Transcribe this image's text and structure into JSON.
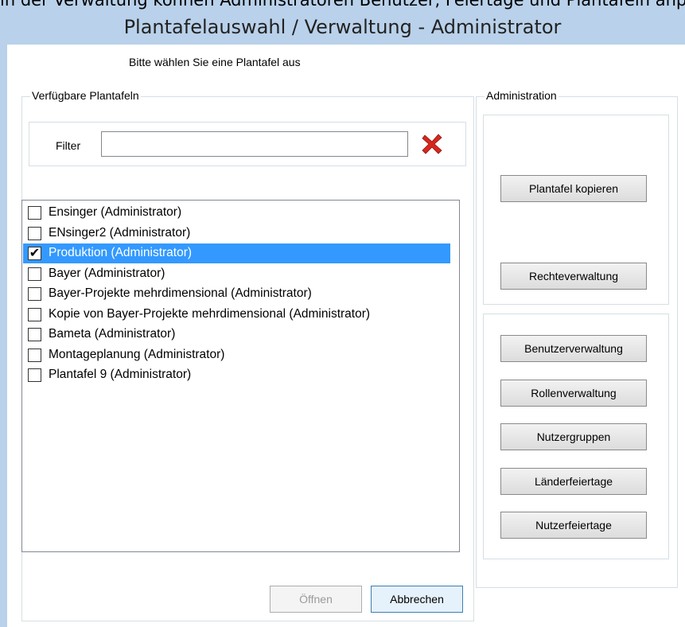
{
  "top_caption": "in der Verwaltung können Administratoren Benutzer, Feiertage und Plantafeln anpassen",
  "window": {
    "title": "Plantafelauswahl / Verwaltung - Administrator"
  },
  "instruction": "Bitte wählen Sie eine Plantafel aus",
  "available": {
    "group_label": "Verfügbare Plantafeln",
    "filter_label": "Filter",
    "filter_value": "",
    "items": [
      {
        "label": "Ensinger (Administrator)",
        "checked": false,
        "selected": false
      },
      {
        "label": "ENsinger2 (Administrator)",
        "checked": false,
        "selected": false
      },
      {
        "label": "Produktion (Administrator)",
        "checked": true,
        "selected": true
      },
      {
        "label": "Bayer (Administrator)",
        "checked": false,
        "selected": false
      },
      {
        "label": "Bayer-Projekte mehrdimensional (Administrator)",
        "checked": false,
        "selected": false
      },
      {
        "label": "Kopie von Bayer-Projekte mehrdimensional (Administrator)",
        "checked": false,
        "selected": false
      },
      {
        "label": "Bameta (Administrator)",
        "checked": false,
        "selected": false
      },
      {
        "label": "Montageplanung (Administrator)",
        "checked": false,
        "selected": false
      },
      {
        "label": "Plantafel 9 (Administrator)",
        "checked": false,
        "selected": false
      }
    ]
  },
  "administration": {
    "group_label": "Administration",
    "copy_button": "Plantafel kopieren",
    "rights_button": "Rechteverwaltung",
    "users_button": "Benutzerverwaltung",
    "roles_button": "Rollenverwaltung",
    "usergroups_button": "Nutzergruppen",
    "country_holidays_button": "Länderfeiertage",
    "user_holidays_button": "Nutzerfeiertage"
  },
  "footer": {
    "open_button": "Öffnen",
    "cancel_button": "Abbrechen"
  },
  "colors": {
    "selection": "#3399ff",
    "title_bar": "#b9d1ea",
    "clear_icon": "#d9261c"
  }
}
